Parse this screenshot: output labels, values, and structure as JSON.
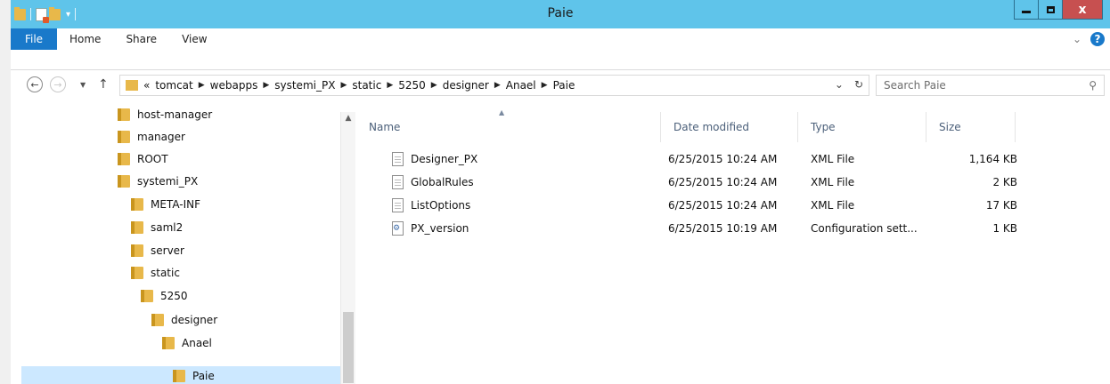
{
  "window": {
    "title": "Paie",
    "minimize_glyph": "—",
    "close_glyph": "x"
  },
  "ribbon": {
    "tabs": [
      "File",
      "Home",
      "Share",
      "View"
    ],
    "expand_glyph": "⌄",
    "help_glyph": "?"
  },
  "address": {
    "back_glyph": "←",
    "forward_glyph": "→",
    "up_glyph": "↑",
    "crumbs": [
      "tomcat",
      "webapps",
      "systemi_PX",
      "static",
      "5250",
      "designer",
      "Anael",
      "Paie"
    ],
    "overflow_glyph": "«",
    "dropdown_glyph": "⌄",
    "refresh_glyph": "↻"
  },
  "search": {
    "placeholder": "Search Paie",
    "icon_glyph": "⚲"
  },
  "nav_tree": [
    {
      "label": "host-manager",
      "level": 0
    },
    {
      "label": "manager",
      "level": 0
    },
    {
      "label": "ROOT",
      "level": 0
    },
    {
      "label": "systemi_PX",
      "level": 0
    },
    {
      "label": "META-INF",
      "level": 1
    },
    {
      "label": "saml2",
      "level": 1
    },
    {
      "label": "server",
      "level": 1
    },
    {
      "label": "static",
      "level": 1
    },
    {
      "label": "5250",
      "level": 2
    },
    {
      "label": "designer",
      "level": 3
    },
    {
      "label": "Anael",
      "level": 4
    },
    {
      "label": "Paie",
      "level": 5,
      "selected": true
    }
  ],
  "list": {
    "columns": {
      "name": "Name",
      "date": "Date modified",
      "type": "Type",
      "size": "Size"
    },
    "rows": [
      {
        "name": "Designer_PX",
        "date": "6/25/2015 10:24 AM",
        "type": "XML File",
        "size": "1,164 KB",
        "icon": "xml-file-icon"
      },
      {
        "name": "GlobalRules",
        "date": "6/25/2015 10:24 AM",
        "type": "XML File",
        "size": "2 KB",
        "icon": "xml-file-icon"
      },
      {
        "name": "ListOptions",
        "date": "6/25/2015 10:24 AM",
        "type": "XML File",
        "size": "17 KB",
        "icon": "xml-file-icon"
      },
      {
        "name": "PX_version",
        "date": "6/25/2015 10:19 AM",
        "type": "Configuration sett...",
        "size": "1 KB",
        "icon": "config-file-icon"
      }
    ]
  },
  "colors": {
    "titlebar": "#5fc4ea",
    "file_tab": "#1979ca",
    "close_button": "#c75050",
    "folder": "#e8b84a",
    "selection": "#cce8ff"
  }
}
